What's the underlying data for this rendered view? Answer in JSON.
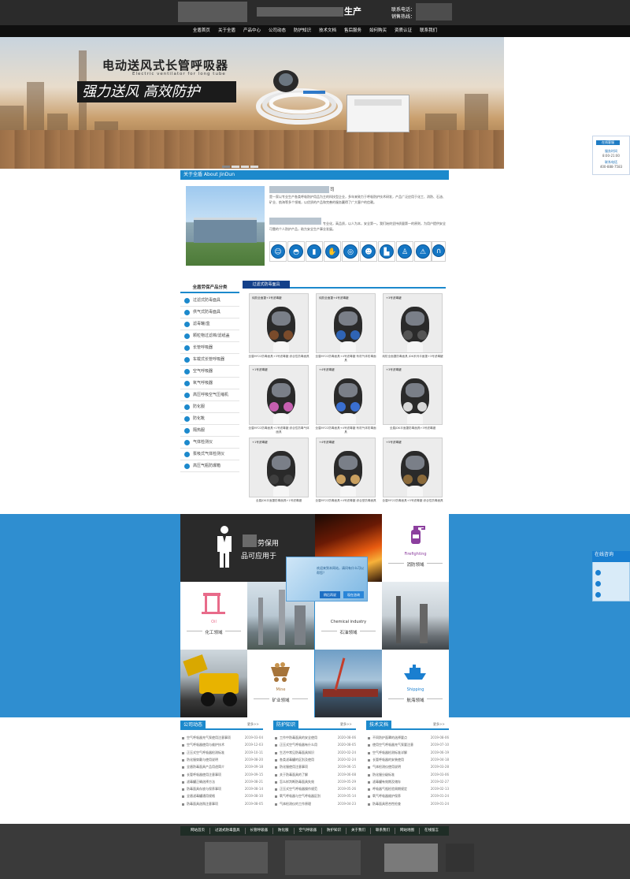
{
  "header": {
    "title_tail": "生产",
    "tel_label": "联系电话：",
    "hotline_label": "销售热线："
  },
  "nav": [
    "全盾首页",
    "关于全盾",
    "产品中心",
    "公司动态",
    "防护知识",
    "技术文档",
    "售后服务",
    "如何购买",
    "资质认证",
    "联系我们"
  ],
  "banner": {
    "heading": "电动送风式长管呼吸器",
    "heading_en": "Electric ventilator for long tube",
    "slogan": "强力送风 高效防护",
    "slides": 4,
    "active_slide": 0
  },
  "service_widget": {
    "header": "在线客服",
    "hours_label": "服务时间",
    "hours": "8:00-21:00",
    "phone_label": "联系电话",
    "phone": "400-888-7583"
  },
  "about": {
    "title": "关于全盾 About JinDun",
    "name_tail": "司",
    "p1": "是一家以专业生产各类呼吸防护用品为主的科技型企业，多年来致力于呼吸防护技术研发，产品广泛应用于化工、消防、石油、矿业、航海等多个领域，以优质的产品和完善的服务赢得了广大客户的信赖。",
    "p2": "专业化，高品质，以人为本，安全第一。我们始终坚持质量第一的原则，为用户提供安全可靠的个人防护产品，助力安全生产事业发展。"
  },
  "categories": {
    "title": "全盾劳保产品分类",
    "items": [
      "过滤式防毒面具",
      "供气式防毒面具",
      "滤毒罐/盒",
      "颗粒物过滤棉/滤纸盖",
      "长管呼吸器",
      "车载式长管呼吸器",
      "空气呼吸器",
      "氧气呼吸器",
      "高压呼吸空气压缩机",
      "防化服",
      "防化靴",
      "隔热服",
      "气体检测仪",
      "泵吸式气体检测仪",
      "高压气瓶防爆箱"
    ]
  },
  "products": {
    "tab": "过滤式防毒面具",
    "items": [
      {
        "title": "纯防全面罩+3号滤毒罐",
        "caption": "全盾MF22防毒面具+3号滤毒罐 综合性防毒面具",
        "filter": "#7a4b2b"
      },
      {
        "title": "纯防全面罩+4号滤毒罐",
        "caption": "全盾MF22防毒面具+4号滤毒罐 有机气体防毒面具",
        "filter": "#2f64b5"
      },
      {
        "title": "+3号滤毒罐",
        "caption": "纯防全面罩防毒面具 JDK系列半面罩+3号滤毒罐",
        "filter": "#555555"
      },
      {
        "title": "+1号滤毒罐",
        "caption": "全盾MF22防毒面具+1号滤毒罐 综合性防毒气体面具",
        "filter": "#c65fb0"
      },
      {
        "title": "+4号滤毒罐",
        "caption": "全盾MF22防毒面具+4号滤毒罐 有机气体防毒面具",
        "filter": "#3a6fd0"
      },
      {
        "title": "+3号滤毒罐",
        "caption": "全盾JDK半面罩防毒面具+3号滤毒罐",
        "filter": "#d8d8d8"
      },
      {
        "title": "+1号滤毒罐",
        "caption": "全盾JDK半面罩防毒面具+1号滤毒罐",
        "filter": "#3f3f3f"
      },
      {
        "title": "+4号滤毒罐",
        "caption": "全盾MF22防毒面具+4号滤毒罐 综合型防毒面具",
        "filter": "#c9a060"
      },
      {
        "title": "+5号滤毒罐",
        "caption": "全盾MF22防毒面具+5号滤毒罐 综合性防毒面具",
        "filter": "#8b6a3a"
      }
    ]
  },
  "applications": {
    "title_line1": "劳保用",
    "title_line2": "品可应用于",
    "firefighting_en": "Firefighting",
    "firefighting_cn": "消防领域",
    "oil_en": "Oil",
    "oil_cn": "化工领域",
    "chemical_en": "Chemical industry",
    "chemical_cn": "石油领域",
    "mine_en": "Mine",
    "mine_cn": "矿业领域",
    "shipping_en": "Shipping",
    "shipping_cn": "航海领域"
  },
  "popup": {
    "text": "欢迎来到本网站，请问有什么可以帮您？",
    "btn_later": "稍后再说",
    "btn_consult": "现在咨询"
  },
  "chat_widget": {
    "title": "在线咨询",
    "rows": [
      "",
      "",
      ""
    ]
  },
  "news": {
    "more_label": "更多>>",
    "columns": [
      {
        "title": "公司动态",
        "items": [
          {
            "t": "空气呼吸器充气泵使用注意事项",
            "d": "2019-03-04"
          },
          {
            "t": "空气呼吸器使用与维护技术",
            "d": "2019-12-03"
          },
          {
            "t": "正压式空气呼吸器检测标准",
            "d": "2019-10-11"
          },
          {
            "t": "防化服穿戴与使用说明",
            "d": "2019-08-20"
          },
          {
            "t": "全盾防毒面具产品用途简介",
            "d": "2019-09-18"
          },
          {
            "t": "长管呼吸器使用注意事项",
            "d": "2019-09-15"
          },
          {
            "t": "滤毒罐正确选择方法",
            "d": "2019-08-21"
          },
          {
            "t": "防毒面具存放与保养事项",
            "d": "2019-08-14"
          },
          {
            "t": "全盾滤毒罐通用规格",
            "d": "2019-08-10"
          },
          {
            "t": "防毒面具选购注意事项",
            "d": "2019-08-05"
          }
        ]
      },
      {
        "title": "防护知识",
        "items": [
          {
            "t": "工作中防毒面具的安全使用",
            "d": "2020-08-06"
          },
          {
            "t": "正压式空气呼吸器有什么用",
            "d": "2020-08-05"
          },
          {
            "t": "生活中常见防毒面具知识",
            "d": "2020-02-24"
          },
          {
            "t": "各类滤毒罐的区别及使用",
            "d": "2020-02-24"
          },
          {
            "t": "防化服使用注意事项",
            "d": "2019-06-15"
          },
          {
            "t": "关于防毒面具的了解",
            "d": "2019-06-08"
          },
          {
            "t": "怎么样判断防毒面具失效",
            "d": "2019-05-29"
          },
          {
            "t": "正压式空气呼吸器操作规范",
            "d": "2019-05-26"
          },
          {
            "t": "氧气呼吸器与空气呼吸器区别",
            "d": "2019-05-14"
          },
          {
            "t": "气体检测仪的工作原理",
            "d": "2019-04-23"
          }
        ]
      },
      {
        "title": "技术文档",
        "items": [
          {
            "t": "不同防护面罩的选择要点",
            "d": "2019-08-06"
          },
          {
            "t": "使用空气呼吸器充气泵要注意",
            "d": "2019-07-10"
          },
          {
            "t": "空气呼吸器检测标准详解",
            "d": "2019-06-19"
          },
          {
            "t": "长管呼吸器的安装使用",
            "d": "2019-04-18"
          },
          {
            "t": "气体检测仪使用说明",
            "d": "2019-03-28"
          },
          {
            "t": "防化服分级标准",
            "d": "2019-03-06"
          },
          {
            "t": "滤毒罐有效期及储存",
            "d": "2019-02-27"
          },
          {
            "t": "呼吸器气瓶检验周期规定",
            "d": "2019-02-13"
          },
          {
            "t": "氧气呼吸器维护保养",
            "d": "2019-01-24"
          },
          {
            "t": "防毒面具密合性检查",
            "d": "2019-01-24"
          }
        ]
      }
    ]
  },
  "footer": {
    "links": [
      "网站首页",
      "过滤式防毒面具",
      "长管呼吸器",
      "防化服",
      "空气呼吸器",
      "防护知识",
      "关于我们",
      "联系我们",
      "网站地图",
      "在线留言"
    ]
  },
  "colors": {
    "accent": "#1c89cc",
    "nav_bg": "#0f0f0f",
    "section_blue": "#2f8ed0"
  }
}
